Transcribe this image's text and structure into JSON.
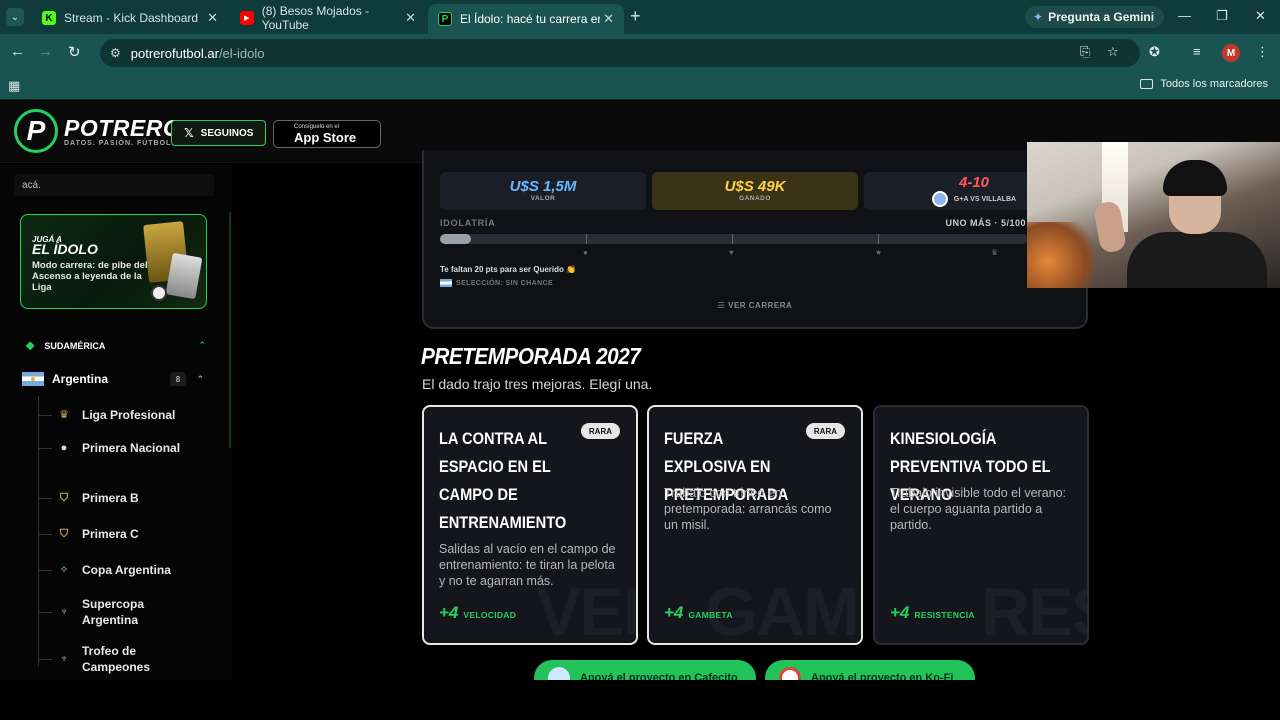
{
  "browser": {
    "tabs": [
      {
        "title": "Stream - Kick Dashboard",
        "favicon": "K",
        "favicon_color": "#53fc18"
      },
      {
        "title": "(8) Besos Mojados - YouTube",
        "favicon": "▶",
        "favicon_color": "#ff0000"
      },
      {
        "title": "El Ídolo: hacé tu carrera en la Li",
        "favicon": "P",
        "favicon_color": "#23d160"
      }
    ],
    "gemini_label": "Pregunta a Gemini",
    "url_host": "potrerofutbol.ar",
    "url_path": "/el-idolo",
    "profile_initial": "M",
    "bookmarks_label": "Todos los marcadores"
  },
  "header": {
    "logo_name": "POTRERO",
    "logo_tagline": "DATOS. PASIÓN. FÚTBOL.",
    "follow_label": "SEGUINOS",
    "appstore_small": "Consíguelo en el",
    "appstore_big": "App Store"
  },
  "sidebar": {
    "search_value": "acá.",
    "promo": {
      "kicker": "JUGÁ A",
      "title": "EL ÍDOLO",
      "desc": "Modo carrera: de pibe del Ascenso a leyenda de la Liga"
    },
    "region": "SUDAMÉRICA",
    "country": "Argentina",
    "country_count": "8",
    "leagues": [
      {
        "name": "Liga Profesional",
        "icon": "trophy-icon"
      },
      {
        "name": "Primera Nacional",
        "icon": "ball-icon"
      },
      {
        "name": "Primera B",
        "icon": "shield-icon"
      },
      {
        "name": "Primera C",
        "icon": "shield-icon"
      },
      {
        "name": "Copa Argentina",
        "icon": "sparkle-icon"
      },
      {
        "name": "Supercopa Argentina",
        "icon": "cup-icon"
      },
      {
        "name": "Trofeo de Campeones",
        "icon": "cup-icon"
      }
    ]
  },
  "career": {
    "value_amount": "U$S 1,5M",
    "value_label": "VALOR",
    "earned_amount": "U$S 49K",
    "earned_label": "GANADO",
    "match_score": "4-10",
    "match_detail": "G+A VS VILLALBA",
    "idol_label": "IDOLATRÍA",
    "idol_status": "UNO MÁS · 5/100",
    "idol_progress": 0.05,
    "missing_text": "Te faltan 20 pts para ser Querido 👏",
    "selection_text": "SELECCIÓN: SIN CHANCE",
    "view_career": "VER CARRERA"
  },
  "preseason": {
    "title": "PRETEMPORADA 2027",
    "subtitle": "El dado trajo tres mejoras. Elegí una.",
    "cards": [
      {
        "title": "LA CONTRA AL ESPACIO EN EL CAMPO DE ENTRENAMIENTO",
        "rarity": "RARA",
        "desc": "Salidas al vacío en el campo de entrenamiento: te tiran la pelota y no te agarran más.",
        "boost": "+4",
        "stat": "VELOCIDAD",
        "watermark": "VEL"
      },
      {
        "title": "FUERZA EXPLOSIVA EN PRETEMPORADA",
        "rarity": "RARA",
        "desc": "Trabajo con trineo en pretemporada: arrancás como un misil.",
        "boost": "+4",
        "stat": "GAMBETA",
        "watermark": "GAMBETA"
      },
      {
        "title": "KINESIOLOGÍA PREVENTIVA TODO EL VERANO",
        "rarity": "",
        "desc": "Trabajo invisible todo el verano: el cuerpo aguanta partido a partido.",
        "boost": "+4",
        "stat": "RESISTENCIA",
        "watermark": "RES"
      }
    ]
  },
  "support": {
    "cafecito_label": "Apoyá el proyecto en Cafecito",
    "kofi_label": "Apoyá el proyecto en Ko-Fi"
  },
  "colors": {
    "accent": "#23d160",
    "browser_frame": "#0f3b3b",
    "browser_toolbar": "#1a5452"
  }
}
